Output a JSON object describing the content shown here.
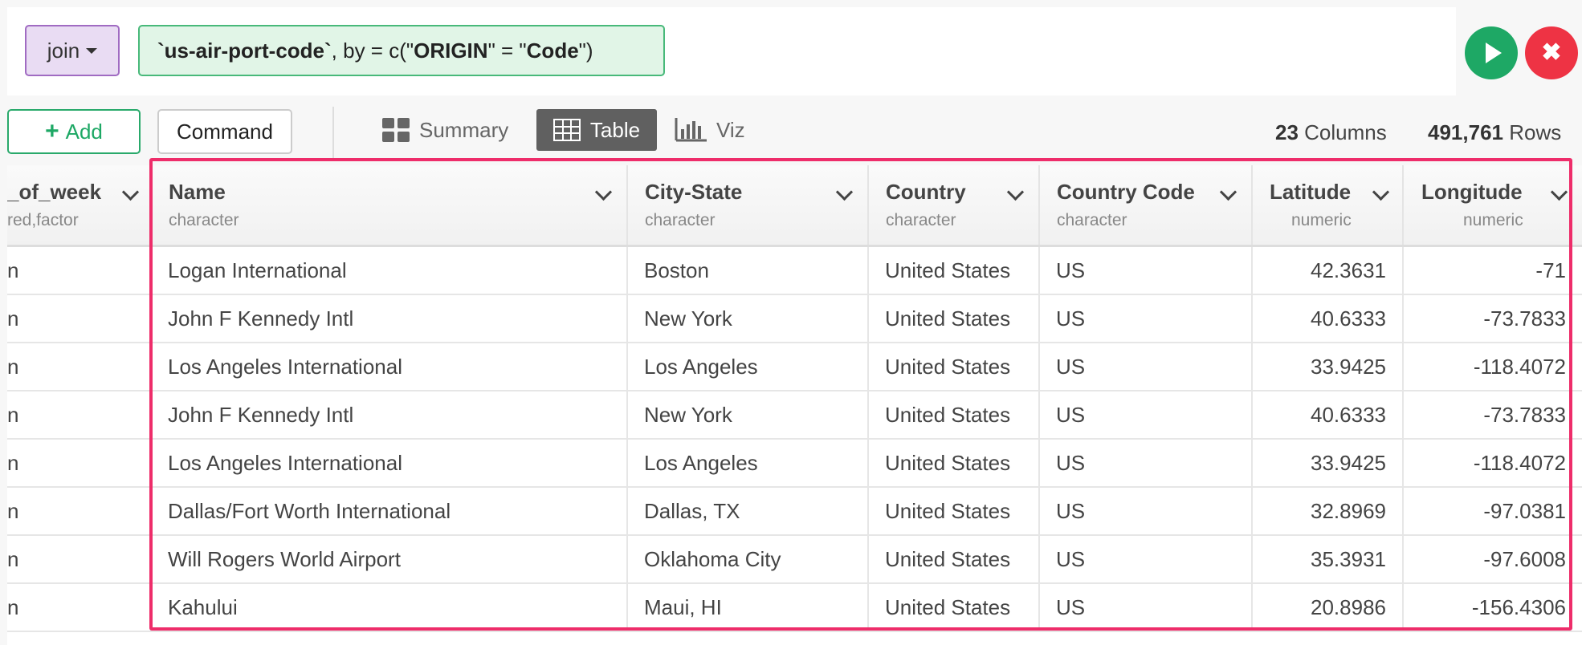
{
  "command_bar": {
    "command_label": "join",
    "expression": {
      "part1": "`us-air-port-code`",
      "part2": ", by = c(\"",
      "part3": "ORIGIN",
      "part4": "\" = \"",
      "part5": "Code",
      "part6": "\")"
    }
  },
  "toolbar": {
    "add_label": "Add",
    "command_label": "Command",
    "tabs": [
      {
        "label": "Summary",
        "icon": "summary-icon"
      },
      {
        "label": "Table",
        "icon": "table-icon",
        "active": true
      },
      {
        "label": "Viz",
        "icon": "chart-icon"
      }
    ],
    "columns_count": "23",
    "columns_label": "Columns",
    "rows_count": "491,761",
    "rows_label": "Rows"
  },
  "colors": {
    "accent_green": "#1ea865",
    "cancel_red": "#ee3344",
    "highlight_pink": "#ee2d6a",
    "join_purple": "#e9dcf3"
  },
  "table": {
    "columns": [
      {
        "name": "_of_week",
        "type": "red,factor"
      },
      {
        "name": "Name",
        "type": "character"
      },
      {
        "name": "City-State",
        "type": "character"
      },
      {
        "name": "Country",
        "type": "character"
      },
      {
        "name": "Country Code",
        "type": "character"
      },
      {
        "name": "Latitude",
        "type": "numeric"
      },
      {
        "name": "Longitude",
        "type": "numeric"
      }
    ],
    "rows": [
      {
        "dow": "n",
        "name": "Logan International",
        "city": "Boston",
        "country": "United States",
        "code": "US",
        "lat": "42.3631",
        "lon": "-71"
      },
      {
        "dow": "n",
        "name": "John F Kennedy Intl",
        "city": "New York",
        "country": "United States",
        "code": "US",
        "lat": "40.6333",
        "lon": "-73.7833"
      },
      {
        "dow": "n",
        "name": "Los Angeles International",
        "city": "Los Angeles",
        "country": "United States",
        "code": "US",
        "lat": "33.9425",
        "lon": "-118.4072"
      },
      {
        "dow": "n",
        "name": "John F Kennedy Intl",
        "city": "New York",
        "country": "United States",
        "code": "US",
        "lat": "40.6333",
        "lon": "-73.7833"
      },
      {
        "dow": "n",
        "name": "Los Angeles International",
        "city": "Los Angeles",
        "country": "United States",
        "code": "US",
        "lat": "33.9425",
        "lon": "-118.4072"
      },
      {
        "dow": "n",
        "name": "Dallas/Fort Worth International",
        "city": "Dallas, TX",
        "country": "United States",
        "code": "US",
        "lat": "32.8969",
        "lon": "-97.0381"
      },
      {
        "dow": "n",
        "name": "Will Rogers World Airport",
        "city": "Oklahoma City",
        "country": "United States",
        "code": "US",
        "lat": "35.3931",
        "lon": "-97.6008"
      },
      {
        "dow": "n",
        "name": "Kahului",
        "city": "Maui, HI",
        "country": "United States",
        "code": "US",
        "lat": "20.8986",
        "lon": "-156.4306"
      }
    ]
  }
}
